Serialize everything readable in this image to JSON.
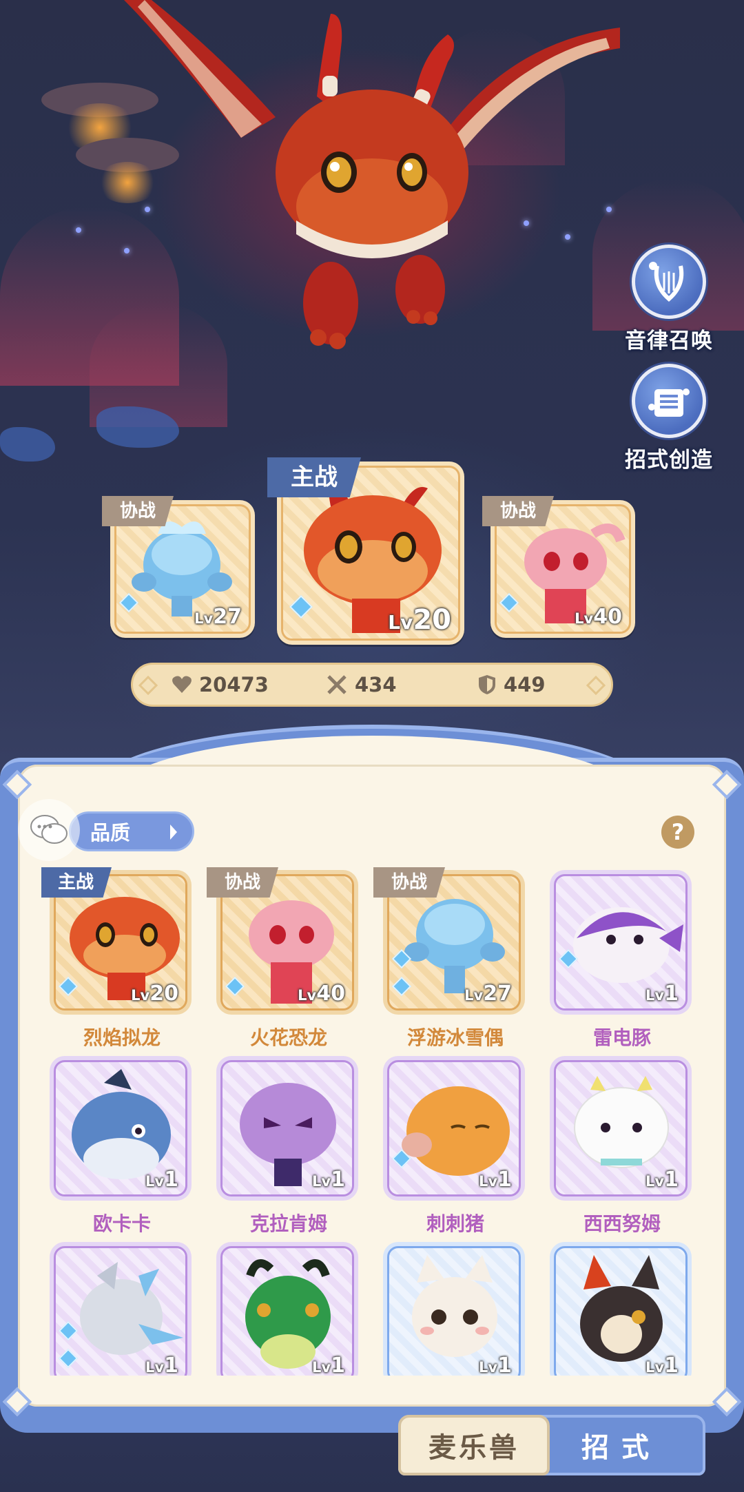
{
  "side_buttons": {
    "summon": {
      "label": "音律召唤",
      "icon": "lyre-icon"
    },
    "skill_create": {
      "label": "招式创造",
      "icon": "music-book-icon"
    }
  },
  "team": {
    "main_tag": "主战",
    "assist_tag": "协战",
    "slots": [
      {
        "role": "协战",
        "name": "浮游冰雪偶",
        "level": "27",
        "theme": "ice"
      },
      {
        "role": "主战",
        "name": "烈焰拟龙",
        "level": "20",
        "theme": "fire"
      },
      {
        "role": "协战",
        "name": "火花恐龙",
        "level": "40",
        "theme": "pink"
      }
    ]
  },
  "stats": {
    "hp": "20473",
    "attack": "434",
    "defense": "449"
  },
  "panel": {
    "filter_label": "品质",
    "help_label": "?"
  },
  "pets": [
    {
      "name": "烈焰拟龙",
      "level": "20",
      "tag": "主战",
      "quality": "gold"
    },
    {
      "name": "火花恐龙",
      "level": "40",
      "tag": "协战",
      "quality": "gold"
    },
    {
      "name": "浮游冰雪偶",
      "level": "27",
      "tag": "协战",
      "quality": "gold"
    },
    {
      "name": "雷电豚",
      "level": "1",
      "tag": "",
      "quality": "purple"
    },
    {
      "name": "欧卡卡",
      "level": "1",
      "tag": "",
      "quality": "purple"
    },
    {
      "name": "克拉肯姆",
      "level": "1",
      "tag": "",
      "quality": "purple"
    },
    {
      "name": "刺刺猪",
      "level": "1",
      "tag": "",
      "quality": "purple"
    },
    {
      "name": "西西努姆",
      "level": "1",
      "tag": "",
      "quality": "purple"
    },
    {
      "name": "",
      "level": "1",
      "tag": "",
      "quality": "purple"
    },
    {
      "name": "",
      "level": "1",
      "tag": "",
      "quality": "purple"
    },
    {
      "name": "",
      "level": "1",
      "tag": "",
      "quality": "blue"
    },
    {
      "name": "",
      "level": "1",
      "tag": "",
      "quality": "blue"
    }
  ],
  "level_prefix": "Lv",
  "tabs": {
    "pets": "麦乐兽",
    "skills": "招式"
  },
  "colors": {
    "panel_blue": "#6d8fd6",
    "main_tag": "#4d6aa6",
    "assist_tag": "#a89584",
    "gold_name": "#d2883a",
    "purple_name": "#b15fbe"
  }
}
